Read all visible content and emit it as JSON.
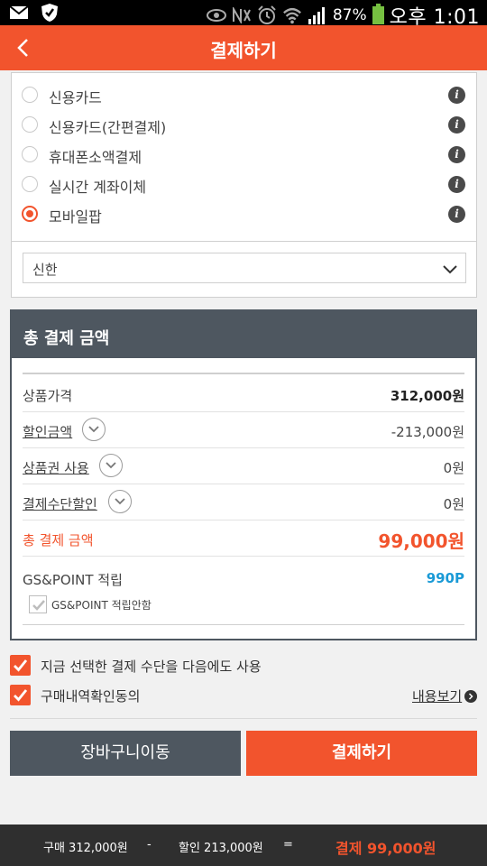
{
  "status_bar": {
    "battery": "87%",
    "time": "오후 1:01"
  },
  "header": {
    "title": "결제하기"
  },
  "payment_methods": [
    {
      "label": "신용카드",
      "selected": false
    },
    {
      "label": "신용카드(간편결제)",
      "selected": false
    },
    {
      "label": "휴대폰소액결제",
      "selected": false
    },
    {
      "label": "실시간 계좌이체",
      "selected": false
    },
    {
      "label": "모바일팝",
      "selected": true
    }
  ],
  "bank_select": {
    "value": "신한"
  },
  "summary": {
    "title": "총 결제 금액",
    "rows": [
      {
        "label": "상품가격",
        "amount": "312,000원"
      },
      {
        "label": "할인금액",
        "amount": "-213,000원"
      },
      {
        "label": "상품권 사용",
        "amount": "0원"
      },
      {
        "label": "결제수단할인",
        "amount": "0원"
      }
    ],
    "total_label": "총 결제 금액",
    "total_amount": "99,000원",
    "point_label": "GS&POINT 적립",
    "point_value": "990P",
    "point_opt_out_label": "GS&POINT 적립안함",
    "point_opt_out_checked": false
  },
  "agreements": {
    "reuse_method": "지금 선택한 결제 수단을 다음에도 사용",
    "confirm_purchase": "구매내역확인동의",
    "detail_link": "내용보기"
  },
  "buttons": {
    "cart": "장바구니이동",
    "pay": "결제하기"
  },
  "footer": {
    "purchase": "구매 312,000원",
    "minus": "-",
    "discount": "할인 213,000원",
    "equals": "=",
    "total": "결제 99,000원"
  },
  "colors": {
    "accent": "#f2542d",
    "dark": "#4e5760",
    "point": "#1a9ad6"
  }
}
